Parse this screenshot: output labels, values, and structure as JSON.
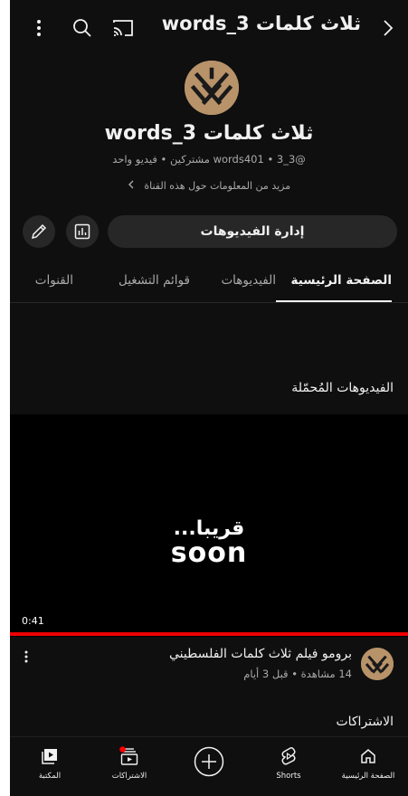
{
  "colors": {
    "background": "#0f0f0f",
    "button": "#272727",
    "progress": "#ee0000",
    "avatar": "#b8936a"
  },
  "header": {
    "title": "ثلاث كلمات 3_words"
  },
  "channel": {
    "name": "ثلاث كلمات 3_words",
    "handle_meta": "@3_words401 • 3 مشتركين • فيديو واحد",
    "more_info": "مزيد من المعلومات حول هذه القناة"
  },
  "actions": {
    "manage_label": "إدارة الفيديوهات"
  },
  "tabs": [
    {
      "label": "الصفحة الرئيسية",
      "active": true
    },
    {
      "label": "الفيديوهات",
      "active": false
    },
    {
      "label": "قوائم التشغيل",
      "active": false
    },
    {
      "label": "القنوات",
      "active": false
    }
  ],
  "uploads": {
    "section_title": "الفيديوهات المُحمّلة",
    "thumb_text_ar": "قريبا...",
    "thumb_text_en": "soon",
    "duration": "0:41",
    "progress_fraction": 1.0,
    "video_title": "برومو فيلم ثلاث كلمات الفلسطيني",
    "video_meta": "14 مشاهدة • قبل 3 أيام"
  },
  "subscriptions_title": "الاشتراكات",
  "nav": [
    {
      "label": "الصفحة الرئيسية",
      "icon": "home-icon"
    },
    {
      "label": "Shorts",
      "icon": "shorts-icon"
    },
    {
      "label": "",
      "icon": "create-plus-icon"
    },
    {
      "label": "الاشتراكات",
      "icon": "subscriptions-icon"
    },
    {
      "label": "المكتبة",
      "icon": "library-icon"
    }
  ]
}
